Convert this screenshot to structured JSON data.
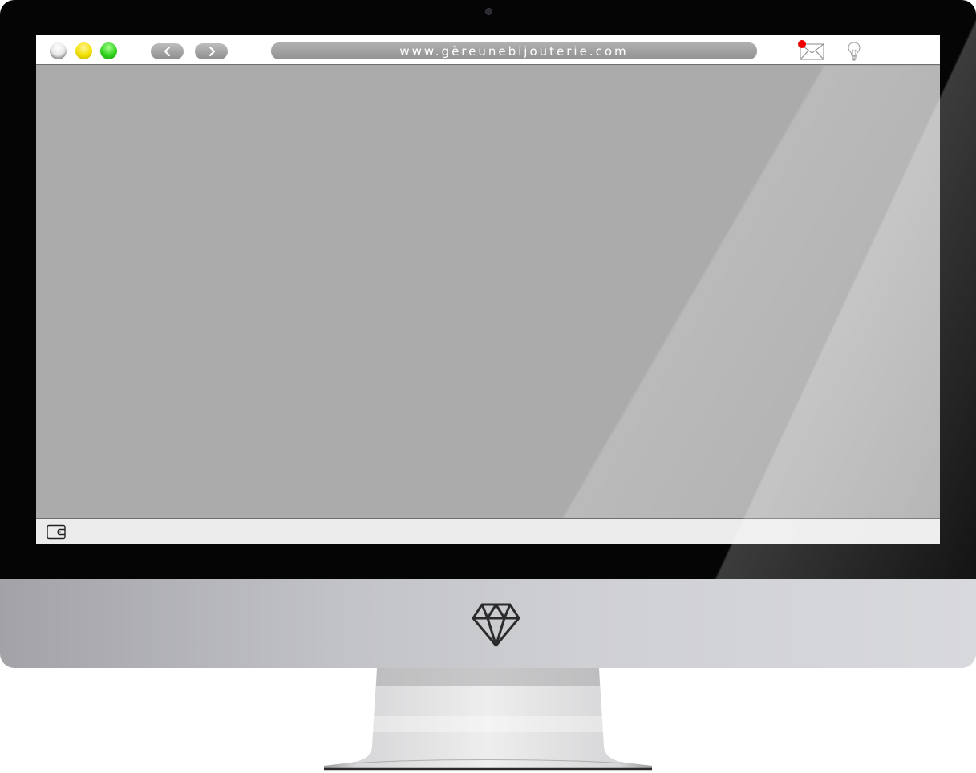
{
  "browser": {
    "url": "www.gèreunebijouterie.com",
    "window_controls": [
      "close",
      "minimize",
      "maximize"
    ],
    "nav": {
      "back_icon": "chevron-left-icon",
      "forward_icon": "chevron-right-icon"
    },
    "notifications": {
      "mail_icon": "envelope-icon",
      "has_unread": true,
      "idea_icon": "lightbulb-icon"
    }
  },
  "status_bar": {
    "icon": "wallet-icon"
  },
  "device": {
    "logo_icon": "diamond-icon"
  },
  "colors": {
    "bezel": "#050505",
    "screen": "#ababab",
    "toolbar": "#ffffff",
    "close_light": "#e6e6e6",
    "minimize_light": "#f2e000",
    "maximize_light": "#2fd11d",
    "url_bar": "#a0a0a0",
    "notification_dot": "#ee0000",
    "chin": "#c8c9cc"
  }
}
